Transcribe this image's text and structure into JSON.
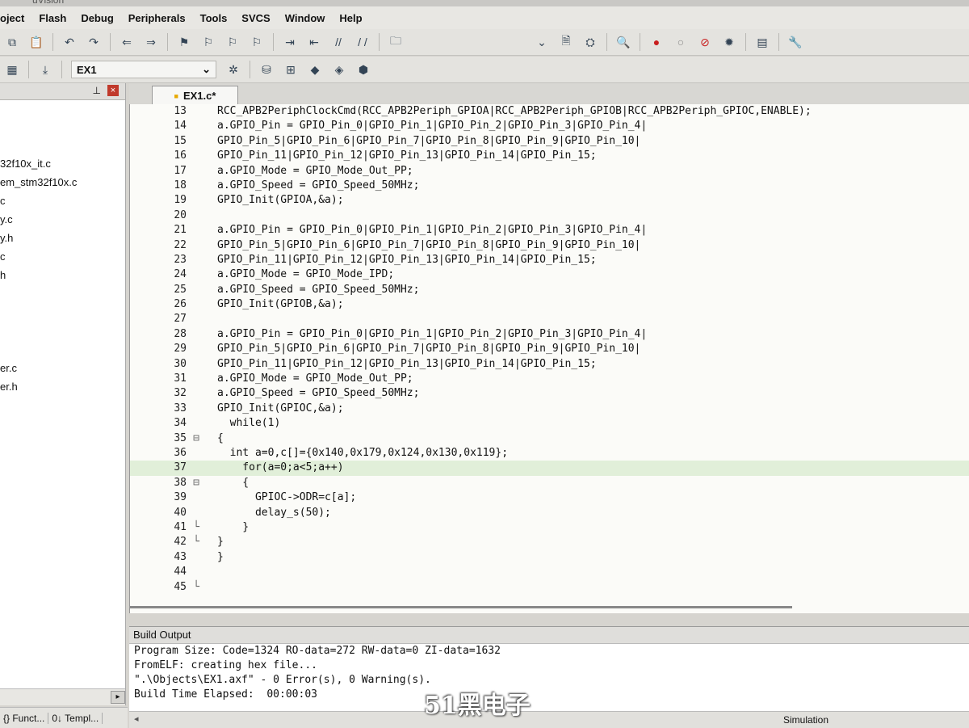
{
  "window": {
    "title": "uVision"
  },
  "menu": [
    "oject",
    "Flash",
    "Debug",
    "Peripherals",
    "Tools",
    "SVCS",
    "Window",
    "Help"
  ],
  "toolbar": {
    "target": "EX1"
  },
  "project_panel": {
    "files": [
      "32f10x_it.c",
      "em_stm32f10x.c",
      "c",
      "y.c",
      "y.h",
      "c",
      "h",
      "",
      "",
      "",
      "",
      "er.c",
      "er.h"
    ]
  },
  "bottom_tabs": [
    "{} Funct...",
    "0↓ Templ..."
  ],
  "editor": {
    "tab_label": "EX1.c*",
    "lines": [
      {
        "n": "13",
        "fold": "",
        "code": "RCC_APB2PeriphClockCmd(RCC_APB2Periph_GPIOA|RCC_APB2Periph_GPIOB|RCC_APB2Periph_GPIOC,ENABLE);"
      },
      {
        "n": "14",
        "fold": "",
        "code": "a.GPIO_Pin = GPIO_Pin_0|GPIO_Pin_1|GPIO_Pin_2|GPIO_Pin_3|GPIO_Pin_4|"
      },
      {
        "n": "15",
        "fold": "",
        "code": "GPIO_Pin_5|GPIO_Pin_6|GPIO_Pin_7|GPIO_Pin_8|GPIO_Pin_9|GPIO_Pin_10|"
      },
      {
        "n": "16",
        "fold": "",
        "code": "GPIO_Pin_11|GPIO_Pin_12|GPIO_Pin_13|GPIO_Pin_14|GPIO_Pin_15;"
      },
      {
        "n": "17",
        "fold": "",
        "code": "a.GPIO_Mode = GPIO_Mode_Out_PP;"
      },
      {
        "n": "18",
        "fold": "",
        "code": "a.GPIO_Speed = GPIO_Speed_50MHz;"
      },
      {
        "n": "19",
        "fold": "",
        "code": "GPIO_Init(GPIOA,&a);"
      },
      {
        "n": "20",
        "fold": "",
        "code": ""
      },
      {
        "n": "21",
        "fold": "",
        "code": "a.GPIO_Pin = GPIO_Pin_0|GPIO_Pin_1|GPIO_Pin_2|GPIO_Pin_3|GPIO_Pin_4|"
      },
      {
        "n": "22",
        "fold": "",
        "code": "GPIO_Pin_5|GPIO_Pin_6|GPIO_Pin_7|GPIO_Pin_8|GPIO_Pin_9|GPIO_Pin_10|"
      },
      {
        "n": "23",
        "fold": "",
        "code": "GPIO_Pin_11|GPIO_Pin_12|GPIO_Pin_13|GPIO_Pin_14|GPIO_Pin_15;"
      },
      {
        "n": "24",
        "fold": "",
        "code": "a.GPIO_Mode = GPIO_Mode_IPD;"
      },
      {
        "n": "25",
        "fold": "",
        "code": "a.GPIO_Speed = GPIO_Speed_50MHz;"
      },
      {
        "n": "26",
        "fold": "",
        "code": "GPIO_Init(GPIOB,&a);"
      },
      {
        "n": "27",
        "fold": "",
        "code": ""
      },
      {
        "n": "28",
        "fold": "",
        "code": "a.GPIO_Pin = GPIO_Pin_0|GPIO_Pin_1|GPIO_Pin_2|GPIO_Pin_3|GPIO_Pin_4|"
      },
      {
        "n": "29",
        "fold": "",
        "code": "GPIO_Pin_5|GPIO_Pin_6|GPIO_Pin_7|GPIO_Pin_8|GPIO_Pin_9|GPIO_Pin_10|"
      },
      {
        "n": "30",
        "fold": "",
        "code": "GPIO_Pin_11|GPIO_Pin_12|GPIO_Pin_13|GPIO_Pin_14|GPIO_Pin_15;"
      },
      {
        "n": "31",
        "fold": "",
        "code": "a.GPIO_Mode = GPIO_Mode_Out_PP;"
      },
      {
        "n": "32",
        "fold": "",
        "code": "a.GPIO_Speed = GPIO_Speed_50MHz;"
      },
      {
        "n": "33",
        "fold": "",
        "code": "GPIO_Init(GPIOC,&a);"
      },
      {
        "n": "34",
        "fold": "",
        "code": "  while(1)"
      },
      {
        "n": "35",
        "fold": "⊟",
        "code": "{"
      },
      {
        "n": "36",
        "fold": "",
        "code": "  int a=0,c[]={0x140,0x179,0x124,0x130,0x119};"
      },
      {
        "n": "37",
        "fold": "",
        "code": "    for(a=0;a<5;a++)",
        "highlight": true
      },
      {
        "n": "38",
        "fold": "⊟",
        "code": "    {"
      },
      {
        "n": "39",
        "fold": "",
        "code": "      GPIOC->ODR=c[a];"
      },
      {
        "n": "40",
        "fold": "",
        "code": "      delay_s(50);"
      },
      {
        "n": "41",
        "fold": "└",
        "code": "    }"
      },
      {
        "n": "42",
        "fold": "└",
        "code": "}"
      },
      {
        "n": "43",
        "fold": "",
        "code": "}"
      },
      {
        "n": "44",
        "fold": "",
        "code": ""
      },
      {
        "n": "45",
        "fold": "└",
        "code": ""
      }
    ]
  },
  "build_output": {
    "title": "Build Output",
    "lines": [
      "Program Size: Code=1324 RO-data=272 RW-data=0 ZI-data=1632",
      "FromELF: creating hex file...",
      "\".\\Objects\\EX1.axf\" - 0 Error(s), 0 Warning(s).",
      "Build Time Elapsed:  00:00:03"
    ]
  },
  "status": {
    "mode": "Simulation"
  },
  "watermark": "51黑电子"
}
